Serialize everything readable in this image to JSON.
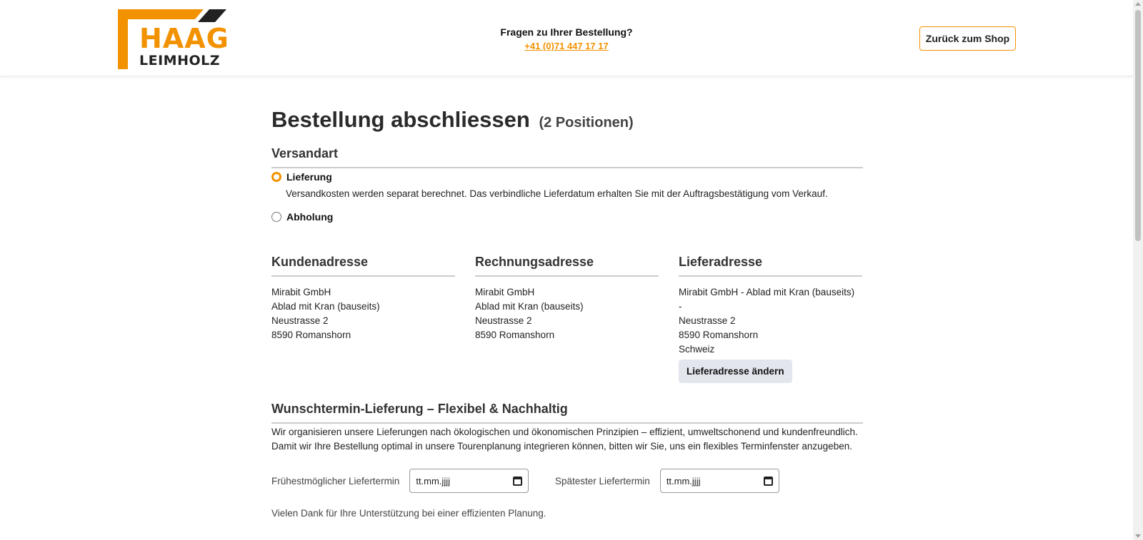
{
  "brand": {
    "name_top": "HAAG",
    "name_bottom": "LEIMHOLZ",
    "accent_color": "#f39200"
  },
  "header": {
    "contact_question": "Fragen zu Ihrer Bestellung?",
    "contact_phone": "+41 (0)71 447 17 17",
    "back_button": "Zurück zum Shop"
  },
  "page": {
    "title": "Bestellung abschliessen",
    "position_count": "(2 Positionen)"
  },
  "shipping": {
    "heading": "Versandart",
    "options": [
      {
        "label": "Lieferung",
        "checked": true,
        "description": "Versandkosten werden separat berechnet. Das verbindliche Lieferdatum erhalten Sie mit der Auftragsbestätigung vom Verkauf."
      },
      {
        "label": "Abholung",
        "checked": false
      }
    ]
  },
  "addresses": {
    "customer": {
      "heading": "Kundenadresse",
      "lines": [
        "Mirabit GmbH",
        "Ablad mit Kran (bauseits)",
        "Neustrasse 2",
        "8590 Romanshorn"
      ]
    },
    "billing": {
      "heading": "Rechnungsadresse",
      "lines": [
        "Mirabit GmbH",
        "Ablad mit Kran (bauseits)",
        "Neustrasse 2",
        "8590 Romanshorn"
      ]
    },
    "delivery": {
      "heading": "Lieferadresse",
      "lines": [
        "Mirabit GmbH - Ablad mit Kran (bauseits)",
        "-",
        "Neustrasse 2",
        "8590 Romanshorn",
        "Schweiz"
      ],
      "change_button": "Lieferadresse ändern"
    }
  },
  "delivery_window": {
    "heading": "Wunschtermin-Lieferung – Flexibel & Nachhaltig",
    "text_1": "Wir organisieren unsere Lieferungen nach ökologischen und ökonomischen Prinzipien – effizient, umweltschonend und kundenfreundlich.",
    "text_2": "Damit wir Ihre Bestellung optimal in unsere Tourenplanung integrieren können, bitten wir Sie, uns ein flexibles Terminfenster anzugeben.",
    "earliest_label": "Frühestmöglicher Liefertermin",
    "earliest_placeholder": "tt.mm.jjjj",
    "latest_label": "Spätester Liefertermin",
    "latest_placeholder": "tt.mm.jjjj",
    "thanks": "Vielen Dank für Ihre Unterstützung bei einer effizienten Planung."
  }
}
